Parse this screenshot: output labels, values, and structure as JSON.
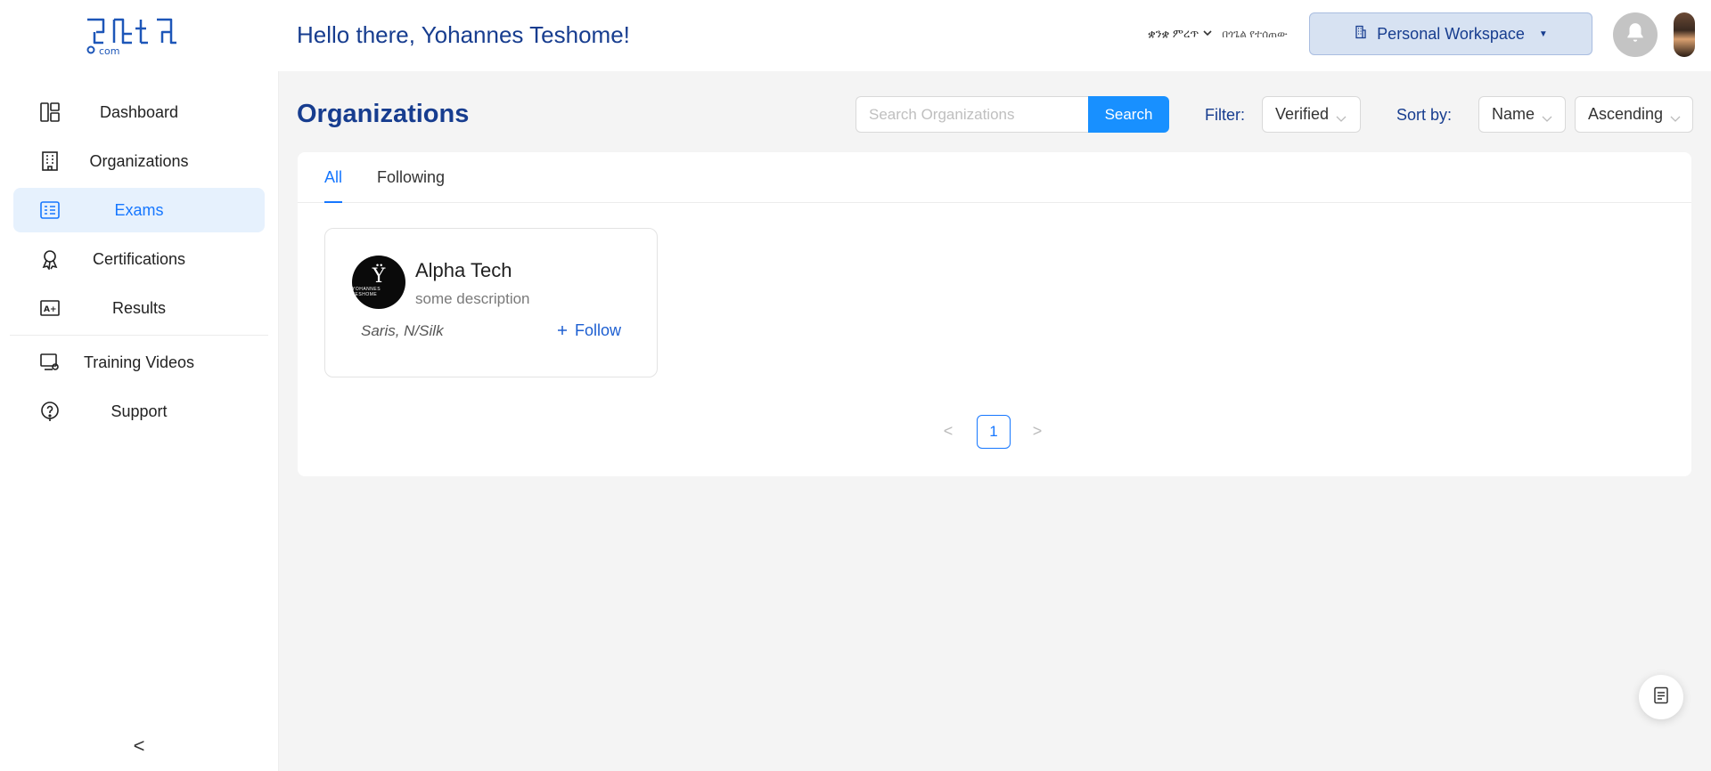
{
  "app": {
    "logo_text": "ፈተና.com"
  },
  "sidebar": {
    "items": [
      {
        "label": "Dashboard",
        "icon": "dashboard-icon",
        "active": false
      },
      {
        "label": "Organizations",
        "icon": "building-icon",
        "active": false
      },
      {
        "label": "Exams",
        "icon": "exam-icon",
        "active": true
      },
      {
        "label": "Certifications",
        "icon": "award-icon",
        "active": false
      },
      {
        "label": "Results",
        "icon": "grade-icon",
        "active": false
      },
      {
        "label": "Training Videos",
        "icon": "video-icon",
        "active": false
      },
      {
        "label": "Support",
        "icon": "help-icon",
        "active": false
      }
    ],
    "collapse_glyph": "<"
  },
  "header": {
    "greeting": "Hello there, Yohannes Teshome!",
    "language": "ቋንቋ ምረጥ",
    "language_hint": "በጎጌል የተሰጠው",
    "workspace": "Personal Workspace"
  },
  "toolbar": {
    "title": "Organizations",
    "search_placeholder": "Search Organizations",
    "search_button": "Search",
    "filter_label": "Filter:",
    "filter_value": "Verified",
    "sort_label": "Sort by:",
    "sort_field": "Name",
    "sort_order": "Ascending"
  },
  "tabs": [
    {
      "label": "All",
      "active": true
    },
    {
      "label": "Following",
      "active": false
    }
  ],
  "organizations": [
    {
      "name": "Alpha Tech",
      "description": "some description",
      "location": "Saris, N/Silk",
      "follow_label": "Follow",
      "logo_mark": "Ϋ",
      "logo_text": "YOHANNES TESHOME"
    }
  ],
  "pagination": {
    "current": "1",
    "prev": "<",
    "next": ">"
  },
  "colors": {
    "accent": "#1677ff",
    "brand_text": "#173d8f",
    "active_bg": "#e6f1fd",
    "workspace_bg": "#d7e2f2"
  }
}
